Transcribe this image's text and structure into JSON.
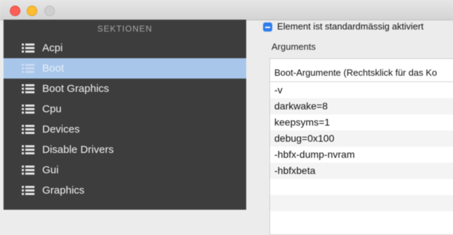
{
  "window": {
    "traffic_lights": [
      "close",
      "minimize",
      "zoom"
    ]
  },
  "sidebar": {
    "header": "SEKTIONEN",
    "items": [
      {
        "label": "Acpi",
        "selected": false
      },
      {
        "label": "Boot",
        "selected": true
      },
      {
        "label": "Boot Graphics",
        "selected": false
      },
      {
        "label": "Cpu",
        "selected": false
      },
      {
        "label": "Devices",
        "selected": false
      },
      {
        "label": "Disable Drivers",
        "selected": false
      },
      {
        "label": "Gui",
        "selected": false
      },
      {
        "label": "Graphics",
        "selected": false
      }
    ]
  },
  "main": {
    "checkbox_label": "Element ist standardmässig aktiviert",
    "checkbox_checked": "mixed",
    "group_label": "Arguments",
    "table": {
      "header": "Boot-Argumente (Rechtsklick für das Ko",
      "rows": [
        "-v",
        "darkwake=8",
        "keepsyms=1",
        "debug=0x100",
        "-hbfx-dump-nvram",
        "-hbfxbeta"
      ]
    }
  },
  "colors": {
    "sidebar_bg": "#3d3d3d",
    "selection": "#a8c6ea",
    "checkbox_accent": "#2f7dea"
  }
}
